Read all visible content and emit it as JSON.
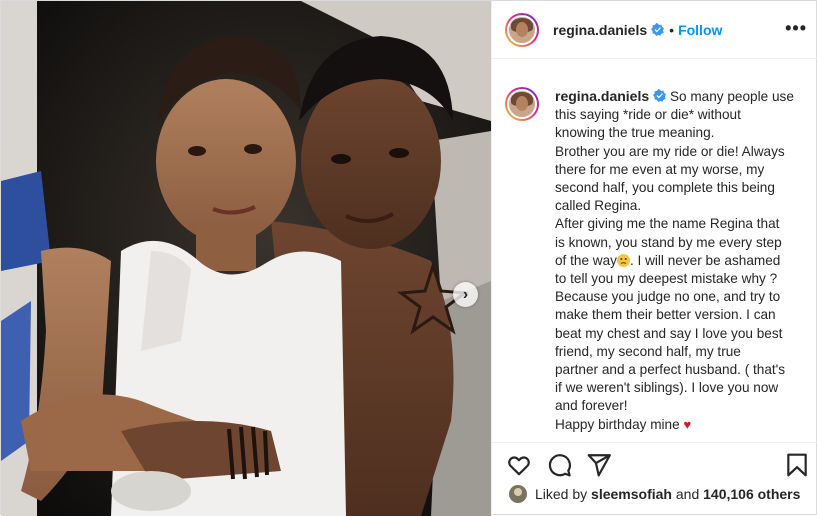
{
  "post": {
    "username": "regina.daniels",
    "separator": "•",
    "follow_label": "Follow",
    "more_icon": "more-options-icon",
    "more_label": "•••",
    "next_icon": "chevron-right-icon",
    "next_label": "›",
    "verified_icon": "verified-badge-icon"
  },
  "caption": {
    "username": "regina.daniels",
    "lines": [
      "So many people use",
      "this saying *ride or die* without",
      "knowing the true meaning.",
      "Brother you are my ride or die! Always",
      "there for me even at my worse, my",
      "second half, you complete this being",
      "called Regina.",
      "After giving me the name Regina that",
      "is known, you stand by me every step",
      "of the way",
      ". I will never be ashamed",
      "to tell you my deepest mistake why ?",
      "Because you judge no one, and try to",
      "make them their better version. I can",
      "beat my chest and say I love you best",
      "friend, my second half, my true",
      "partner and a perfect husband. ( that's",
      "if we weren't siblings). I love you now",
      "and forever!",
      "Happy birthday mine"
    ],
    "heart": "♥"
  },
  "actions": {
    "like_icon": "heart-icon",
    "comment_icon": "comment-icon",
    "share_icon": "share-icon",
    "save_icon": "bookmark-icon"
  },
  "likes": {
    "prefix": "Liked by",
    "user": "sleemsofiah",
    "joiner": "and",
    "count_text": "140,106 others"
  },
  "colors": {
    "accent": "#0095f6",
    "text": "#262626",
    "border": "#efefef",
    "heart_emoji": "#d11b2d"
  }
}
